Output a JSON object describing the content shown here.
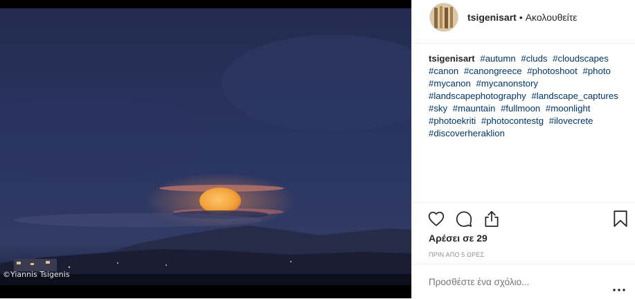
{
  "photo": {
    "watermark": "©Yiannis Tsigenis"
  },
  "header": {
    "username": "tsigenisart",
    "separator": "•",
    "follow_label": "Ακολουθείτε"
  },
  "caption": {
    "username": "tsigenisart",
    "hashtags": [
      "#autumn",
      "#cluds",
      "#cloudscapes",
      "#canon",
      "#canongreece",
      "#photoshoot",
      "#photo",
      "#mycanon",
      "#mycanonstory",
      "#landscapephotography",
      "#landscape_captures",
      "#sky",
      "#mauntain",
      "#fullmoon",
      "#moonlight",
      "#photoekriti",
      "#photocontestg",
      "#ilovecrete",
      "#discoverheraklion"
    ]
  },
  "actions": {
    "icons": [
      "heart-icon",
      "comment-icon",
      "share-icon",
      "bookmark-icon"
    ]
  },
  "likes_text": "Αρέσει σε 29",
  "timestamp": "ΠΡΙΝ ΑΠΟ 5 ΩΡΕΣ",
  "comment": {
    "placeholder": "Προσθέστε ένα σχόλιο...",
    "more_icon": "more-options-icon"
  }
}
